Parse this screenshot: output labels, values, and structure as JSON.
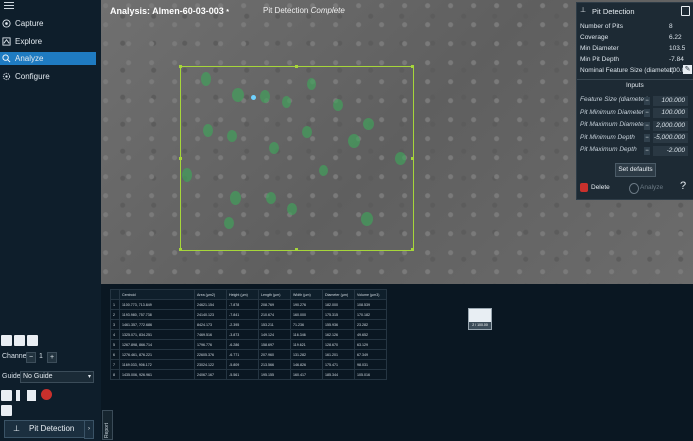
{
  "sidebar": {
    "nav": [
      {
        "label": "Capture",
        "icon": "capture-icon",
        "active": false
      },
      {
        "label": "Explore",
        "icon": "explore-icon",
        "active": false
      },
      {
        "label": "Analyze",
        "icon": "analyze-icon",
        "active": true
      },
      {
        "label": "Configure",
        "icon": "gear-icon",
        "active": false
      }
    ],
    "channel_label": "Channel",
    "channel_value": "1",
    "guide_label": "Guide",
    "guide_value": "No Guide",
    "pit_detection_button": "Pit Detection"
  },
  "viewer": {
    "title": "Analysis: Almen-60-03-003",
    "title_suffix": "*",
    "status_prefix": "Pit Detection",
    "status_value": "Complete"
  },
  "panel": {
    "title": "Pit Detection",
    "results": [
      {
        "label": "Number of Pits",
        "value": "8"
      },
      {
        "label": "Coverage",
        "value": "6.22"
      },
      {
        "label": "Min Diameter",
        "value": "103.5"
      },
      {
        "label": "Min Pit Depth",
        "value": "-7.84"
      },
      {
        "label": "Nominal Feature Size (diameter)",
        "value": "100.0"
      }
    ],
    "inputs_header": "Inputs",
    "inputs": [
      {
        "label": "Feature Size (diameter)",
        "value": "100.000"
      },
      {
        "label": "Pit Minimum Diameter",
        "value": "100.000"
      },
      {
        "label": "Pit Maximum Diameter",
        "value": "2,000.000"
      },
      {
        "label": "Pit Minimum Depth",
        "value": "-5,000.000"
      },
      {
        "label": "Pit Maximum Depth",
        "value": "-2.000"
      }
    ],
    "set_defaults": "Set defaults",
    "delete": "Delete",
    "analyze": "Analyze",
    "help": "?"
  },
  "table": {
    "columns": [
      "",
      "Centroid",
      "Area (µm2)",
      "Height (µm)",
      "Length (µm)",
      "Width (µm)",
      "Diameter (µm)",
      "Volume (µm3)"
    ],
    "rows": [
      [
        "1",
        "1100.773, 713.849",
        "24621.154",
        "-7.878",
        "208.769",
        "190.276",
        "182.000",
        "108.539"
      ],
      [
        "2",
        "1193.980, 757.738",
        "24140.123",
        "-7.841",
        "210.674",
        "160.000",
        "175.315",
        "170.182"
      ],
      [
        "3",
        "1461.357, 772.686",
        "8424.173",
        "-2.395",
        "153.211",
        "71.236",
        "155.936",
        "23.282"
      ],
      [
        "4",
        "1325.071, 834.251",
        "7469.516",
        "-3.873",
        "149.124",
        "116.346",
        "162.126",
        "49.652"
      ],
      [
        "5",
        "1267.898, 866.714",
        "1796.776",
        "-6.286",
        "158.697",
        "119.621",
        "128.670",
        "63.129"
      ],
      [
        "6",
        "1276.461, 876.221",
        "22605.376",
        "-6.771",
        "207.960",
        "131.282",
        "161.201",
        "67.349"
      ],
      [
        "7",
        "1169.033, 906.172",
        "23024.122",
        "-5.809",
        "213.566",
        "146.826",
        "175.471",
        "98.031"
      ],
      [
        "8",
        "1435.006, 926.961",
        "24067.167",
        "-5.561",
        "195.155",
        "160.417",
        "185.344",
        "105.016"
      ]
    ],
    "report_tab": "Report"
  },
  "thumbnail": {
    "label": "2 / 100.00"
  },
  "colors": {
    "accent": "#1f7bc1",
    "roi": "#a6d63a",
    "pit": "#3fa55a"
  }
}
